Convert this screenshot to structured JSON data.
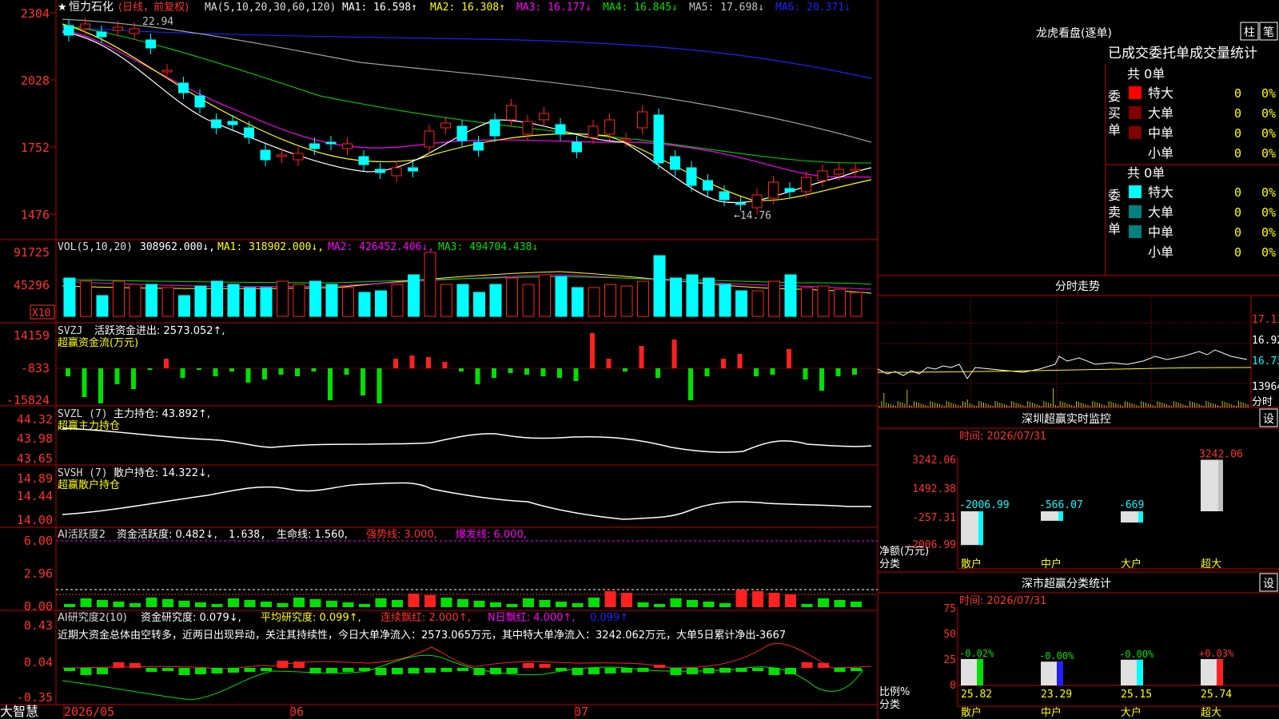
{
  "stock": {
    "name": "恒力石化",
    "period_tag": "(日线，前复权)",
    "ma_label": "MA(5,10,20,30,60,120)",
    "ma1": "MA1: 16.598↑",
    "ma2": "MA2: 16.308↑",
    "ma3": "MA3: 16.177↓",
    "ma4": "MA4: 16.845↓",
    "ma5": "MA5: 17.698↓",
    "ma6": "MA6: 20.371↓",
    "high_note": "22.94",
    "low_note": "←14.76"
  },
  "price_axis": [
    "2304",
    "2028",
    "1752",
    "1476"
  ],
  "vol": {
    "label": "VOL(5,10,20)",
    "value": "308962.000↓,",
    "ma1": "MA1: 318902.000↓,",
    "ma2": "MA2: 426452.406↓,",
    "ma3": "MA3: 494704.438↓",
    "axis": [
      "91725",
      "45296"
    ],
    "unit": "X10"
  },
  "svzj": {
    "label": "SVZJ",
    "text": "活跃资金进出: 2573.052↑,",
    "sub": "超赢资金流(万元)",
    "axis": [
      "14159",
      "-833",
      "-15824"
    ]
  },
  "svzl": {
    "label": "SVZL (7)",
    "text": "主力持仓: 43.892↑,",
    "sub": "超赢主力持仓",
    "axis": [
      "44.32",
      "43.98",
      "43.65"
    ]
  },
  "svsh": {
    "label": "SVSH (7)",
    "text": "散户持仓: 14.322↓,",
    "sub": "超赢散户持仓",
    "axis": [
      "14.89",
      "14.44",
      "14.00"
    ]
  },
  "ai1": {
    "label": "AI活跃度2",
    "t1": "资金活跃度: 0.482↓,",
    "t2": "1.638,",
    "t3": "生命线: 1.560,",
    "t4": "强势线: 3.000,",
    "t5": "爆发线: 6.000,",
    "axis": [
      "6.00",
      "2.96",
      "0.00"
    ]
  },
  "ai2": {
    "label": "AI研究度2(10)",
    "t1": "资金研究度: 0.079↓,",
    "t2": "平均研究度: 0.099↑,",
    "t3": "连续飘红: 2.000↑,",
    "t4": "N日飘红: 4.000↑,",
    "t5": "0.099↑",
    "comment": "近期大资金总体由空转多，近两日出现异动，关注其持续性，今日大单净流入：2573.065万元，其中特大单净流入：3242.062万元，大单5日累计净出-3667",
    "axis": [
      "0.43",
      "0.04",
      "-0.35"
    ]
  },
  "footer": {
    "brand": "大智慧",
    "dates": [
      "2026/05",
      "06",
      "07"
    ]
  },
  "right": {
    "lhb_title": "龙虎看盘(逐单)",
    "btn_zhu": "柱",
    "btn_bi": "笔",
    "tabs": "已成交委托单成交量统计",
    "buy_label": "委买单",
    "sell_label": "委卖单",
    "buy_total": "共 0单",
    "sell_total": "共 0单",
    "buy_rows": [
      {
        "label": "特大",
        "count": "0",
        "pct": "0%"
      },
      {
        "label": "大单",
        "count": "0",
        "pct": "0%"
      },
      {
        "label": "中单",
        "count": "0",
        "pct": "0%"
      },
      {
        "label": "小单",
        "count": "0",
        "pct": "0%"
      }
    ],
    "sell_rows": [
      {
        "label": "特大",
        "count": "0",
        "pct": "0%"
      },
      {
        "label": "大单",
        "count": "0",
        "pct": "0%"
      },
      {
        "label": "中单",
        "count": "0",
        "pct": "0%"
      },
      {
        "label": "小单",
        "count": "0",
        "pct": "0%"
      }
    ],
    "intraday_title": "分时走势",
    "intraday_axis": [
      "17.11",
      "16.92",
      "16.73",
      "13964",
      "分时"
    ],
    "monitor_title": "深圳超赢实时监控",
    "monitor_btn": "设",
    "monitor_time": "时间: 2026/07/31",
    "monitor_axis": [
      "3242.06",
      "1492.38",
      "-257.31",
      "-2006.99"
    ],
    "monitor_ylabel": "净额(万元)",
    "monitor_xlabel": "分类",
    "monitor_cats": [
      "散户",
      "中户",
      "大户",
      "超大"
    ],
    "monitor_vals": [
      "-2006.99",
      "-566.07",
      "-669",
      "3242.06"
    ],
    "stat_title": "深市超赢分类统计",
    "stat_btn": "设",
    "stat_time": "时间: 2026/07/31",
    "stat_axis": [
      "75",
      "50",
      "25",
      "0"
    ],
    "stat_ylabel": "比例%",
    "stat_xlabel": "分类",
    "stat_cats": [
      "散户",
      "中户",
      "大户",
      "超大"
    ],
    "stat_changes": [
      "-0.02%",
      "-0.00%",
      "-0.00%",
      "+0.03%"
    ],
    "stat_vals": [
      "25.82",
      "23.29",
      "25.15",
      "25.74"
    ]
  },
  "colors": {
    "up": "#ff2020",
    "down": "#00ffff",
    "grid": "#c00000",
    "green": "#00e000",
    "yellow": "#ffff00",
    "magenta": "#ff00ff"
  }
}
